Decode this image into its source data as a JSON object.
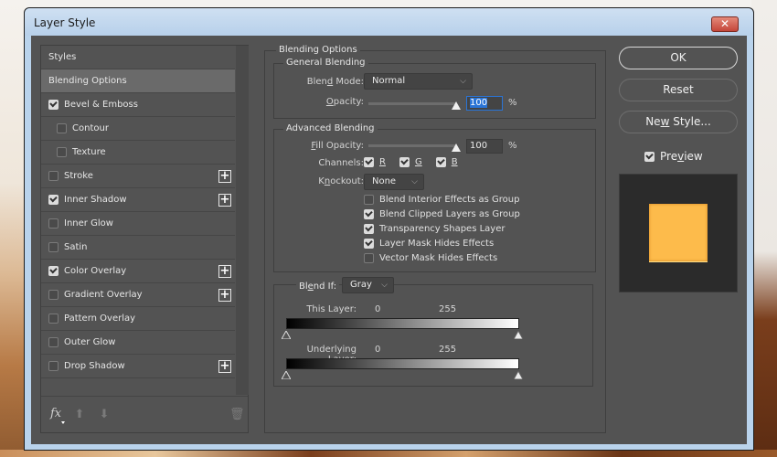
{
  "window": {
    "title": "Layer Style",
    "close_label": "✕"
  },
  "styles_panel": {
    "items": [
      {
        "label": "Styles",
        "type": "header",
        "checked": null,
        "plus": false
      },
      {
        "label": "Blending Options",
        "type": "selected",
        "checked": null,
        "plus": false
      },
      {
        "label": "Bevel & Emboss",
        "type": "item",
        "checked": true,
        "plus": false
      },
      {
        "label": "Contour",
        "type": "sub",
        "checked": false,
        "plus": false
      },
      {
        "label": "Texture",
        "type": "sub",
        "checked": false,
        "plus": false
      },
      {
        "label": "Stroke",
        "type": "item",
        "checked": false,
        "plus": true
      },
      {
        "label": "Inner Shadow",
        "type": "item",
        "checked": true,
        "plus": true
      },
      {
        "label": "Inner Glow",
        "type": "item",
        "checked": false,
        "plus": false
      },
      {
        "label": "Satin",
        "type": "item",
        "checked": false,
        "plus": false
      },
      {
        "label": "Color Overlay",
        "type": "item",
        "checked": true,
        "plus": true
      },
      {
        "label": "Gradient Overlay",
        "type": "item",
        "checked": false,
        "plus": true
      },
      {
        "label": "Pattern Overlay",
        "type": "item",
        "checked": false,
        "plus": false
      },
      {
        "label": "Outer Glow",
        "type": "item",
        "checked": false,
        "plus": false
      },
      {
        "label": "Drop Shadow",
        "type": "item",
        "checked": false,
        "plus": true
      }
    ],
    "footer": {
      "fx_label": "fx",
      "up_icon": "arrow-up-icon",
      "down_icon": "arrow-down-icon",
      "trash_icon": "trash-icon"
    }
  },
  "blending": {
    "section_title": "Blending Options",
    "general": {
      "title": "General Blending",
      "blend_mode_label": "Blend Mode:",
      "blend_mode_value": "Normal",
      "opacity_label": "Opacity:",
      "opacity_value": "100",
      "opacity_fraction": 1.0,
      "pct": "%"
    },
    "advanced": {
      "title": "Advanced Blending",
      "fill_opacity_label": "Fill Opacity:",
      "fill_opacity_value": "100",
      "fill_opacity_fraction": 1.0,
      "pct": "%",
      "channels_label": "Channels:",
      "channels": [
        {
          "label": "R",
          "checked": true
        },
        {
          "label": "G",
          "checked": true
        },
        {
          "label": "B",
          "checked": true
        }
      ],
      "knockout_label": "Knockout:",
      "knockout_value": "None",
      "options": [
        {
          "label": "Blend Interior Effects as Group",
          "checked": false
        },
        {
          "label": "Blend Clipped Layers as Group",
          "checked": true
        },
        {
          "label": "Transparency Shapes Layer",
          "checked": true
        },
        {
          "label": "Layer Mask Hides Effects",
          "checked": true
        },
        {
          "label": "Vector Mask Hides Effects",
          "checked": false
        }
      ]
    },
    "blend_if": {
      "label": "Blend If:",
      "value": "Gray",
      "this_layer_label": "This Layer:",
      "this_layer_min": "0",
      "this_layer_max": "255",
      "underlying_label": "Underlying Layer:",
      "underlying_min": "0",
      "underlying_max": "255"
    }
  },
  "buttons": {
    "ok": "OK",
    "reset": "Reset",
    "new_style": "New Style...",
    "preview_label": "Preview",
    "preview_checked": true
  },
  "preview": {
    "swatch_color": "#fdbb4b",
    "background_color": "#2b2b2b"
  }
}
